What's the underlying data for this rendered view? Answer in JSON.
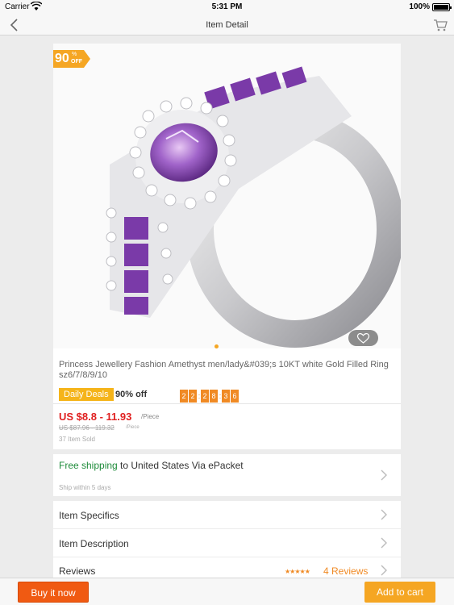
{
  "status_bar": {
    "carrier": "Carrier",
    "time": "5:31 PM",
    "battery": "100%"
  },
  "nav": {
    "title": "Item Detail",
    "back_icon": "chevron-left-icon",
    "cart_icon": "shopping-cart-icon"
  },
  "product": {
    "discount_badge": {
      "value": "90",
      "percent_sign": "%",
      "suffix": "OFF"
    },
    "title": "Princess Jewellery Fashion Amethyst men/lady&#039;s 10KT white Gold Filled Ring sz6/7/8/9/10",
    "deals_label": "Daily Deals",
    "deals_percent": "90% off",
    "countdown": [
      "2",
      "2",
      "2",
      "8",
      "3",
      "6"
    ],
    "price": "US $8.8 - 11.93",
    "price_unit": "/Piece",
    "old_price": "US $87.96 - 119.32",
    "old_price_unit": "/Piece",
    "sold": "37 Item Sold"
  },
  "shipping": {
    "free_label": "Free shipping",
    "rest": " to United States Via ePacket",
    "sub": "Ship within 5 days"
  },
  "rows": {
    "specifics": "Item Specifics",
    "description": "Item Description",
    "reviews": "Reviews",
    "stars": "★★★★★",
    "review_count": "4 Reviews"
  },
  "bottom_bar": {
    "buy_now": "Buy it now",
    "add_to_cart": "Add to cart"
  },
  "colors": {
    "accent": "#f5a623",
    "price_red": "#e02020",
    "free_shipping_green": "#1f8c3b",
    "buy_now": "#f05a12"
  }
}
